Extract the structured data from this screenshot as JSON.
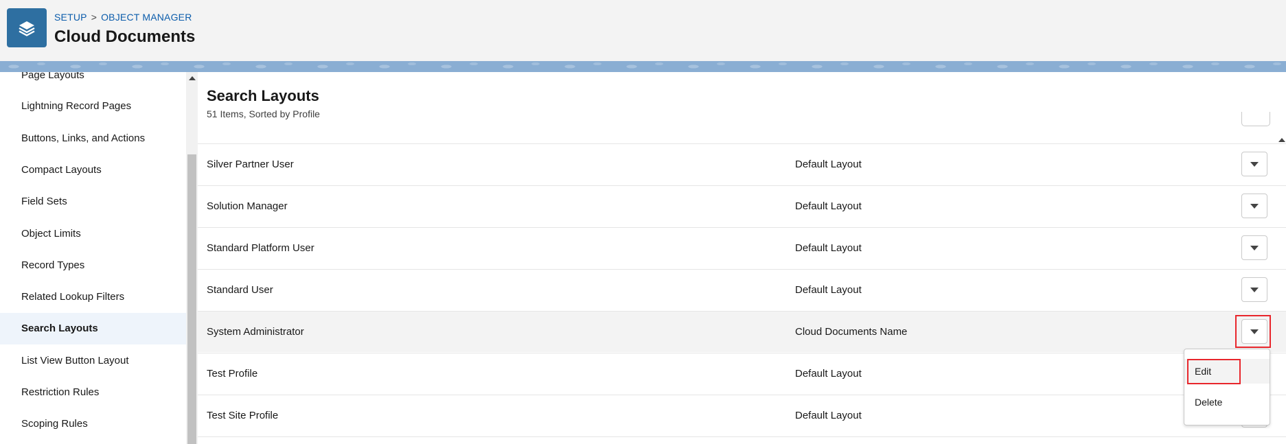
{
  "header": {
    "breadcrumb": [
      "SETUP",
      ">",
      "OBJECT MANAGER"
    ],
    "title": "Cloud Documents",
    "app_icon": "layers-icon"
  },
  "sidebar": {
    "items": [
      {
        "label": "Page Layouts",
        "active": false
      },
      {
        "label": "Lightning Record Pages",
        "active": false
      },
      {
        "label": "Buttons, Links, and Actions",
        "active": false
      },
      {
        "label": "Compact Layouts",
        "active": false
      },
      {
        "label": "Field Sets",
        "active": false
      },
      {
        "label": "Object Limits",
        "active": false
      },
      {
        "label": "Record Types",
        "active": false
      },
      {
        "label": "Related Lookup Filters",
        "active": false
      },
      {
        "label": "Search Layouts",
        "active": true
      },
      {
        "label": "List View Button Layout",
        "active": false
      },
      {
        "label": "Restriction Rules",
        "active": false
      },
      {
        "label": "Scoping Rules",
        "active": false
      }
    ]
  },
  "main": {
    "title": "Search Layouts",
    "subtitle": "51 Items, Sorted by Profile",
    "rows": [
      {
        "profile": "Silver Partner User",
        "layout": "Default Layout",
        "selected": false
      },
      {
        "profile": "Solution Manager",
        "layout": "Default Layout",
        "selected": false
      },
      {
        "profile": "Standard Platform User",
        "layout": "Default Layout",
        "selected": false
      },
      {
        "profile": "Standard User",
        "layout": "Default Layout",
        "selected": false
      },
      {
        "profile": "System Administrator",
        "layout": "Cloud Documents Name",
        "selected": true
      },
      {
        "profile": "Test Profile",
        "layout": "Default Layout",
        "selected": false
      },
      {
        "profile": "Test Site Profile",
        "layout": "Default Layout",
        "selected": false
      }
    ]
  },
  "dropdown": {
    "items": [
      "Edit",
      "Delete"
    ]
  },
  "colors": {
    "brand": "#2e6fa1",
    "link": "#0b5cab",
    "highlight": "#e8262c",
    "band": "#8aaed3"
  }
}
